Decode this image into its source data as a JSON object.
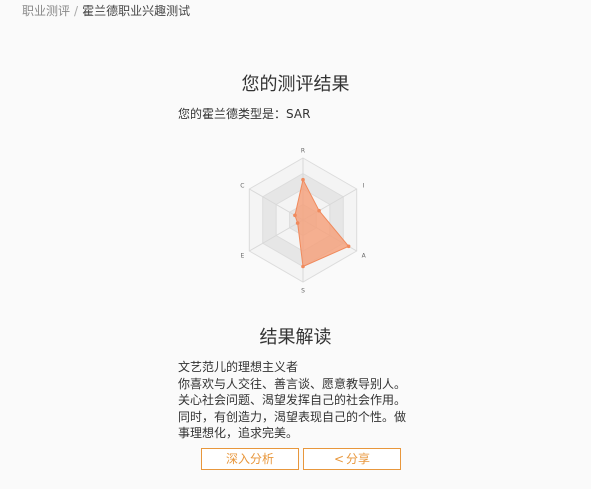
{
  "breadcrumb": {
    "parent": "职业测评",
    "separator": "/",
    "current": "霍兰德职业兴趣测试"
  },
  "result": {
    "title": "您的测评结果",
    "type_label": "您的霍兰德类型是：",
    "type_value": "SAR"
  },
  "chart_data": {
    "type": "radar",
    "axes": [
      "R",
      "I",
      "A",
      "S",
      "E",
      "C"
    ],
    "values": [
      0.65,
      0.3,
      0.85,
      0.75,
      0.1,
      0.15
    ],
    "max": 1,
    "rings": 4,
    "series_color": "#f5a27e",
    "ring_fill_a": "#e6e6e6",
    "ring_fill_b": "#f4f4f4"
  },
  "interpretation": {
    "title": "结果解读",
    "subtitle": "文艺范儿的理想主义者",
    "body": "你喜欢与人交往、善言谈、愿意教导别人。关心社会问题、渴望发挥自己的社会作用。同时，有创造力，渴望表现自己的个性。做事理想化，追求完美。"
  },
  "buttons": {
    "analysis_label": "深入分析",
    "share_icon": "share-icon",
    "share_label": "分享"
  }
}
